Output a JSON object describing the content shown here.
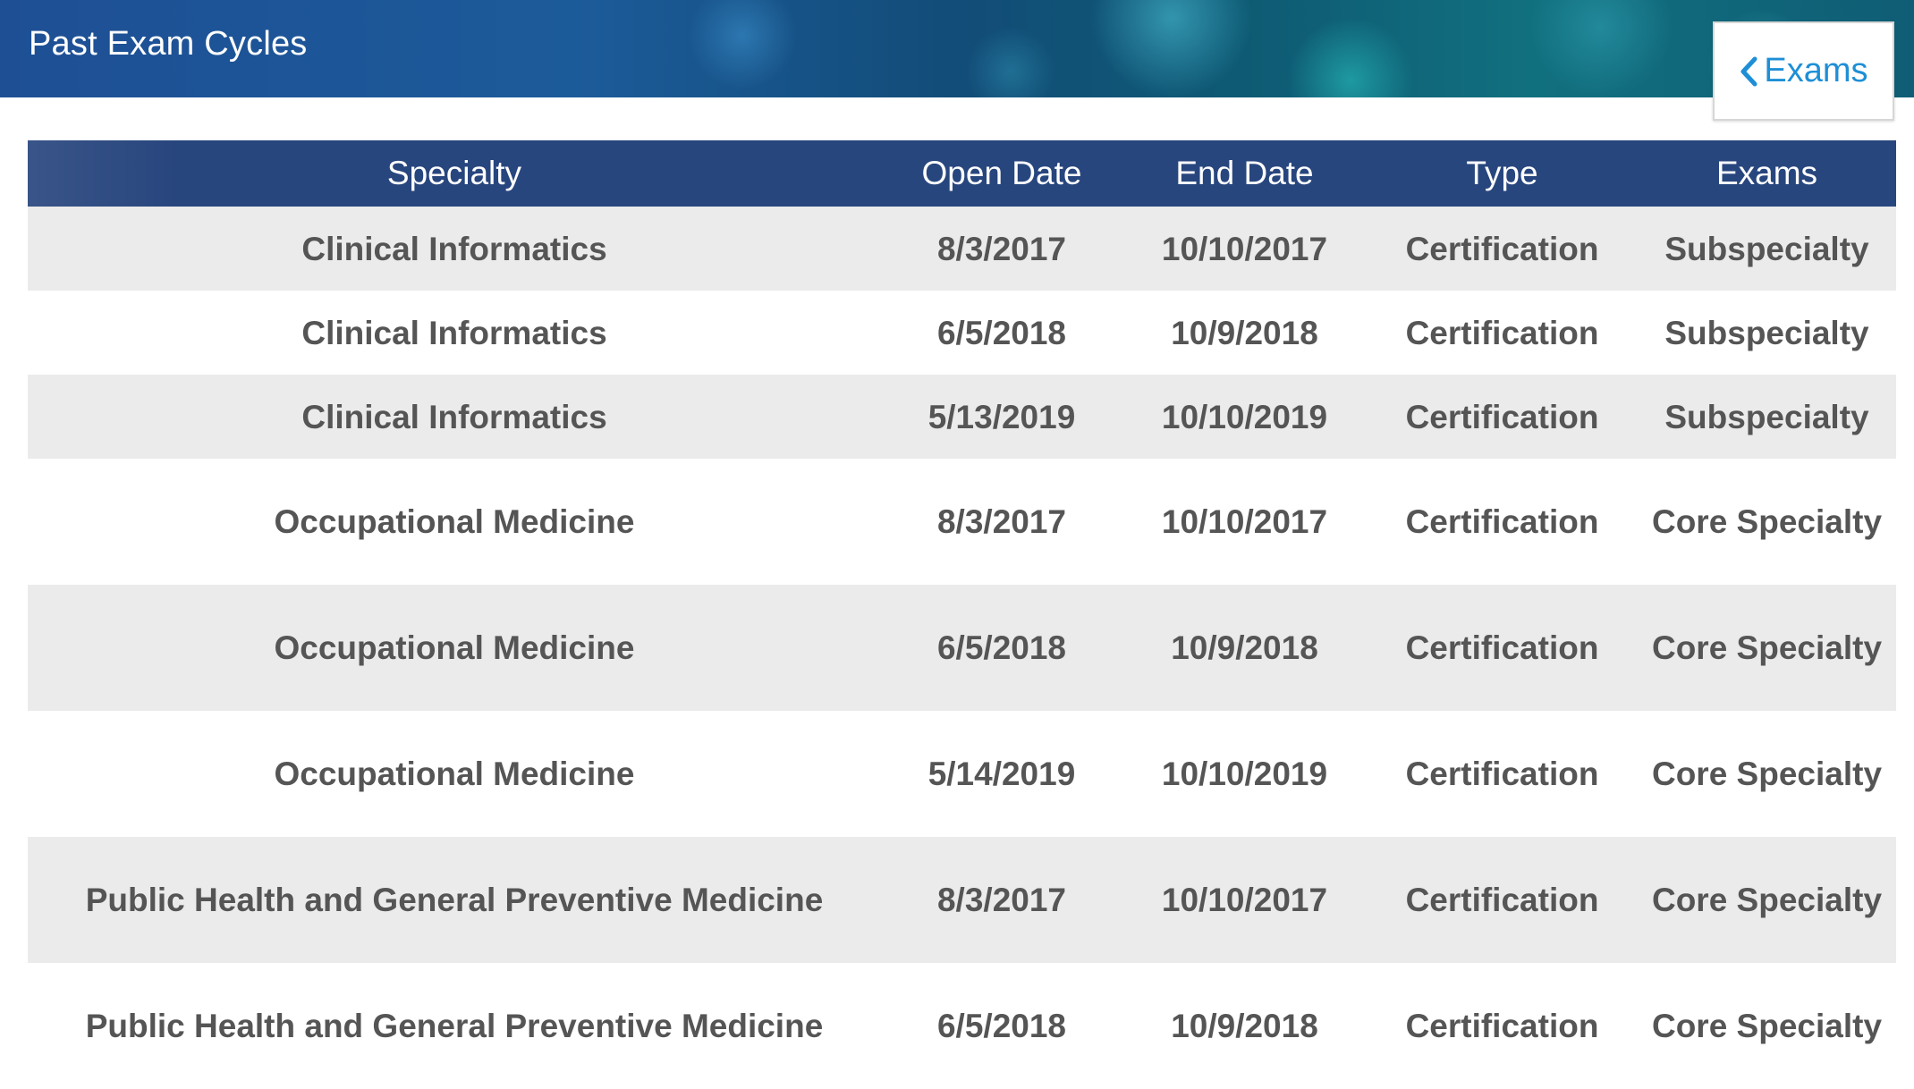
{
  "header": {
    "title": "Past Exam Cycles",
    "back_label": "Exams"
  },
  "table": {
    "columns": [
      "Specialty",
      "Open Date",
      "End Date",
      "Type",
      "Exams"
    ],
    "rows": [
      {
        "specialty": "Clinical Informatics",
        "open_date": "8/3/2017",
        "end_date": "10/10/2017",
        "type": "Certification",
        "exams": "Subspecialty"
      },
      {
        "specialty": "Clinical Informatics",
        "open_date": "6/5/2018",
        "end_date": "10/9/2018",
        "type": "Certification",
        "exams": "Subspecialty"
      },
      {
        "specialty": "Clinical Informatics",
        "open_date": "5/13/2019",
        "end_date": "10/10/2019",
        "type": "Certification",
        "exams": "Subspecialty"
      },
      {
        "specialty": "Occupational Medicine",
        "open_date": "8/3/2017",
        "end_date": "10/10/2017",
        "type": "Certification",
        "exams": "Core Specialty"
      },
      {
        "specialty": "Occupational Medicine",
        "open_date": "6/5/2018",
        "end_date": "10/9/2018",
        "type": "Certification",
        "exams": "Core Specialty"
      },
      {
        "specialty": "Occupational Medicine",
        "open_date": "5/14/2019",
        "end_date": "10/10/2019",
        "type": "Certification",
        "exams": "Core Specialty"
      },
      {
        "specialty": "Public Health and General Preventive Medicine",
        "open_date": "8/3/2017",
        "end_date": "10/10/2017",
        "type": "Certification",
        "exams": "Core Specialty"
      },
      {
        "specialty": "Public Health and General Preventive Medicine",
        "open_date": "6/5/2018",
        "end_date": "10/9/2018",
        "type": "Certification",
        "exams": "Core Specialty"
      }
    ]
  },
  "icons": {
    "back": "chevron-left-icon"
  },
  "colors": {
    "header_bg": "#28467e",
    "link": "#1e8fd6",
    "row_alt": "#ebebeb",
    "text": "#555555"
  }
}
